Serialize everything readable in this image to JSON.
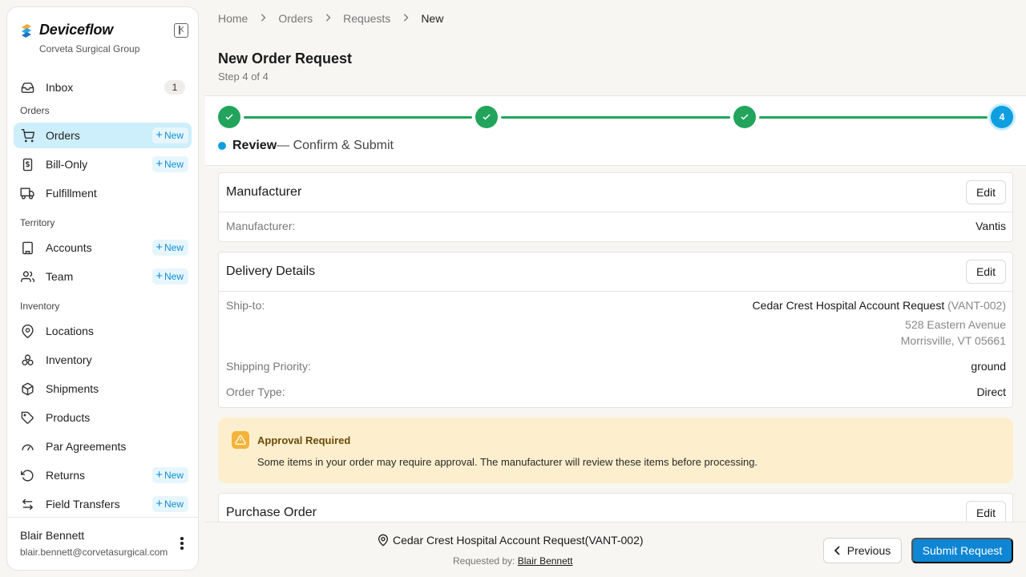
{
  "sidebar": {
    "brand": "Deviceflow",
    "org": "Corveta Surgical Group",
    "inbox": {
      "label": "Inbox",
      "count": "1"
    },
    "sections": {
      "orders": "Orders",
      "territory": "Territory",
      "inventory": "Inventory"
    },
    "items": {
      "orders": "Orders",
      "bill_only": "Bill-Only",
      "fulfillment": "Fulfillment",
      "accounts": "Accounts",
      "team": "Team",
      "locations": "Locations",
      "inventory": "Inventory",
      "shipments": "Shipments",
      "products": "Products",
      "par_agreements": "Par Agreements",
      "returns": "Returns",
      "field_transfers": "Field Transfers"
    },
    "new_label": "New",
    "user": {
      "name": "Blair Bennett",
      "email": "blair.bennett@corvetasurgical.com"
    }
  },
  "breadcrumb": [
    "Home",
    "Orders",
    "Requests",
    "New"
  ],
  "page": {
    "title": "New Order Request",
    "subtitle": "Step 4 of 4"
  },
  "stepper": {
    "current_step": "4",
    "current_title": "Review",
    "current_desc": "— Confirm & Submit",
    "colors": {
      "complete": "#22a45d",
      "current": "#0f9ee0"
    }
  },
  "cards": {
    "manufacturer": {
      "title": "Manufacturer",
      "edit": "Edit",
      "label": "Manufacturer:",
      "value": "Vantis"
    },
    "delivery": {
      "title": "Delivery Details",
      "edit": "Edit",
      "ship_to_label": "Ship-to:",
      "ship_to_name": "Cedar Crest Hospital Account Request",
      "ship_to_code": "(VANT-002)",
      "address_line1": "528 Eastern Avenue",
      "address_line2": "Morrisville, VT 05661",
      "priority_label": "Shipping Priority:",
      "priority_value": "ground",
      "order_type_label": "Order Type:",
      "order_type_value": "Direct"
    },
    "purchase_order": {
      "title": "Purchase Order",
      "edit": "Edit"
    }
  },
  "alert": {
    "title": "Approval Required",
    "text": "Some items in your order may require approval. The manufacturer will review these items before processing."
  },
  "footer": {
    "account": "Cedar Crest Hospital Account Request(VANT-002)",
    "requested_by_label": "Requested by:",
    "requested_by_name": "Blair Bennett",
    "previous": "Previous",
    "submit": "Submit Request"
  }
}
